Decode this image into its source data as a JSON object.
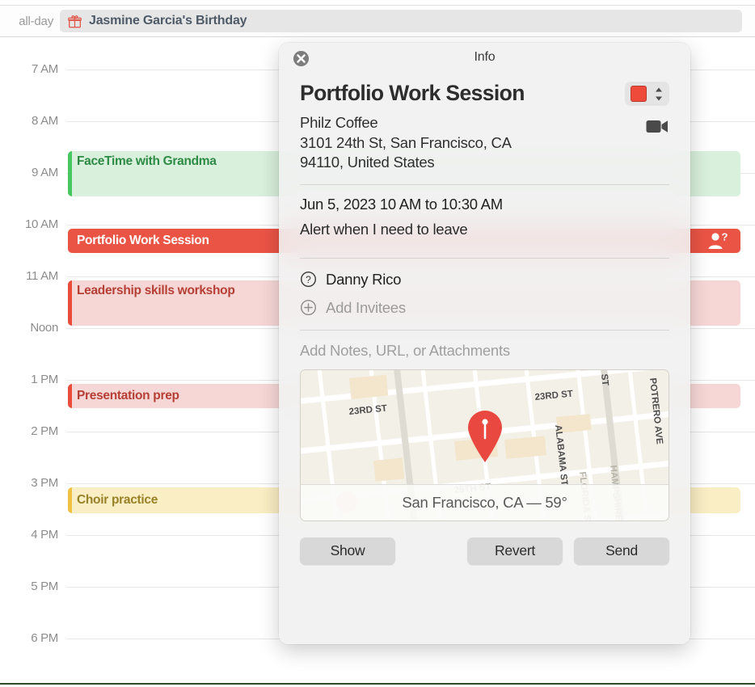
{
  "calendar": {
    "allday": {
      "label": "all-day",
      "event_title": "Jasmine Garcia's Birthday",
      "icon": "gift-icon"
    },
    "hours": [
      "7 AM",
      "8 AM",
      "9 AM",
      "10 AM",
      "11 AM",
      "Noon",
      "1 PM",
      "2 PM",
      "3 PM",
      "4 PM",
      "5 PM",
      "6 PM"
    ],
    "events": [
      {
        "title": "FaceTime with Grandma",
        "style": "green",
        "accent": "#47c761"
      },
      {
        "title": "Portfolio Work Session",
        "style": "solid",
        "accent": "#ea5445",
        "badge": "person-question-icon"
      },
      {
        "title": "Leadership skills workshop",
        "style": "pink",
        "accent": "#e84c3d"
      },
      {
        "title": "Presentation prep",
        "style": "pink",
        "accent": "#e84c3d"
      },
      {
        "title": "Choir practice",
        "style": "yellow",
        "accent": "#f0c243"
      }
    ]
  },
  "popover": {
    "window_title": "Info",
    "close_label": "Close",
    "event_name": "Portfolio Work Session",
    "color": "#ee4b3a",
    "location_name": "Philz Coffee",
    "location_address_line1": "3101 24th St, San Francisco, CA",
    "location_address_line2": "94110, United States",
    "date": "Jun 5, 2023",
    "time_range": "10 AM to 10:30 AM",
    "datetime_line": "Jun 5, 2023  10 AM to 10:30 AM",
    "alert": "Alert when I need to leave",
    "invitee": "Danny Rico",
    "invitee_status_icon": "question-circle-icon",
    "add_invitees": "Add Invitees",
    "notes_placeholder": "Add Notes, URL, or Attachments",
    "map": {
      "caption": "San Francisco, CA — 59°",
      "city": "San Francisco, CA",
      "temperature": "59°",
      "street_labels": [
        "23RD ST",
        "23RD ST",
        "25TH ST",
        "ALABAMA ST",
        "FLORIDA ST",
        "POTRERO AVE",
        "HAMPSHIRE ST",
        "ST"
      ]
    },
    "buttons": {
      "show": "Show",
      "revert": "Revert",
      "send": "Send"
    }
  }
}
